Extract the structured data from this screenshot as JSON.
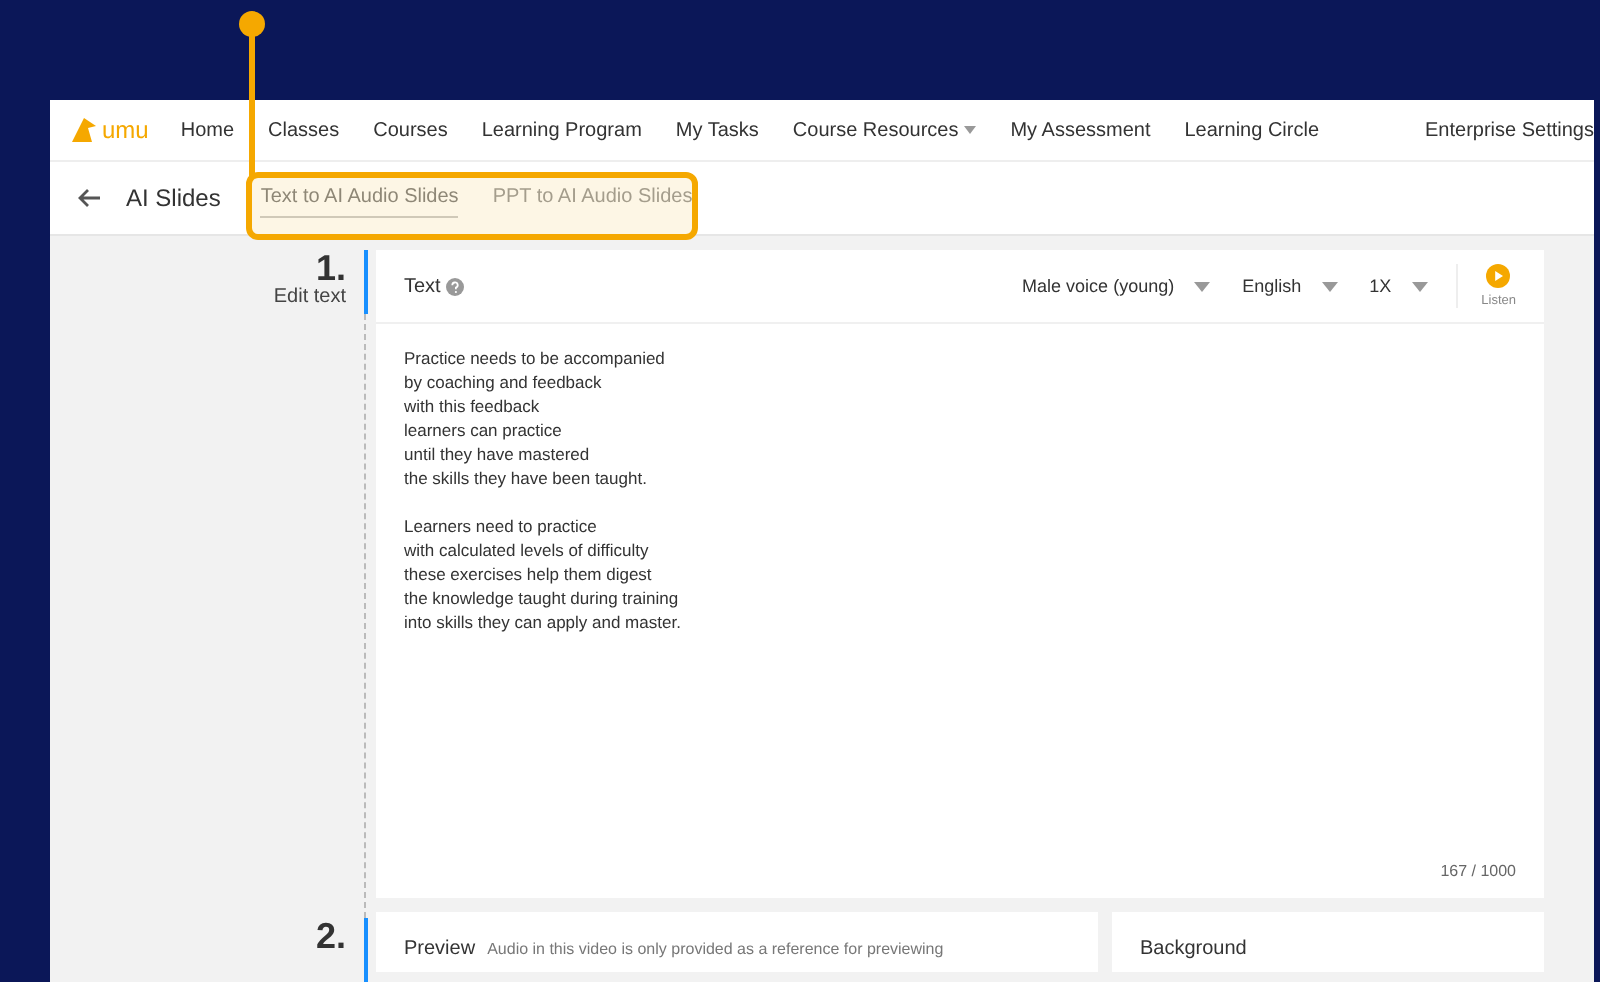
{
  "nav": {
    "logo": "umu",
    "items": [
      {
        "label": "Home",
        "dropdown": false
      },
      {
        "label": "Classes",
        "dropdown": false
      },
      {
        "label": "Courses",
        "dropdown": false
      },
      {
        "label": "Learning Program",
        "dropdown": false
      },
      {
        "label": "My Tasks",
        "dropdown": false
      },
      {
        "label": "Course Resources",
        "dropdown": true
      },
      {
        "label": "My Assessment",
        "dropdown": false
      },
      {
        "label": "Learning Circle",
        "dropdown": false
      }
    ],
    "right": "Enterprise Settings"
  },
  "subheader": {
    "title": "AI Slides",
    "tabs": [
      {
        "label": "Text to AI Audio Slides",
        "selected": true
      },
      {
        "label": "PPT to AI Audio Slides",
        "selected": false
      }
    ]
  },
  "steps": [
    {
      "number": "1.",
      "label": "Edit text"
    },
    {
      "number": "2."
    }
  ],
  "editor": {
    "title": "Text",
    "selects": [
      "Male voice (young)",
      "English",
      "1X"
    ],
    "listen": "Listen",
    "paragraphs": [
      [
        "Practice needs to be accompanied",
        "by coaching and feedback",
        "with this feedback",
        "learners can practice",
        "until they have mastered",
        "the skills they have been taught."
      ],
      [
        "Learners need to practice",
        "with calculated levels of difficulty",
        "these exercises help them digest",
        "the knowledge taught during training",
        "into skills they can apply and master."
      ]
    ],
    "count": "167 / 1000"
  },
  "preview": {
    "title": "Preview",
    "note": "Audio in this video is only provided as a reference for previewing"
  },
  "background": {
    "title": "Background"
  }
}
